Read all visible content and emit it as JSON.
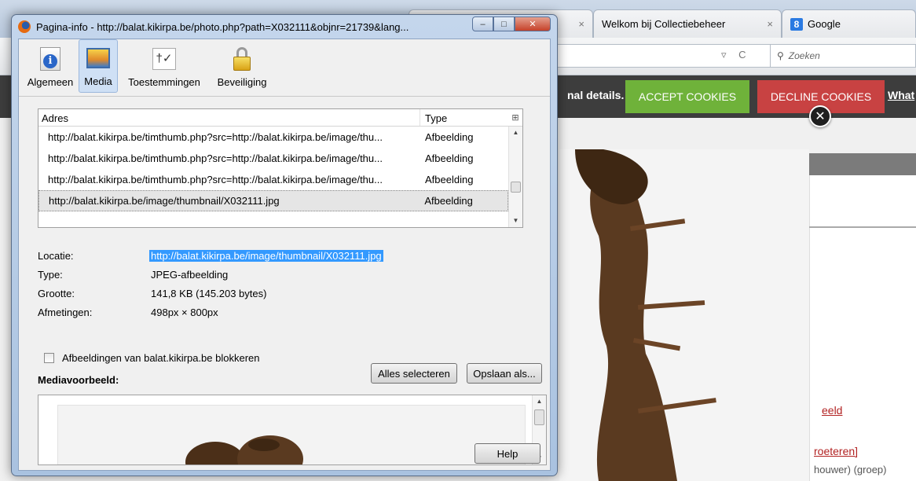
{
  "browser": {
    "tabs": [
      {
        "label": "",
        "close": "×"
      },
      {
        "label": "Welkom bij Collectiebeheer",
        "close": "×"
      },
      {
        "label": "Google",
        "icon": "google-icon"
      }
    ],
    "search_placeholder": "Zoeken",
    "url_icons": "▿ C"
  },
  "cookie_bar": {
    "text": "nal details.",
    "accept_label": "ACCEPT COOKIES",
    "decline_label": "DECLINE COOKIES",
    "what_label": "What",
    "close_glyph": "✕",
    "colors": {
      "accept": "#6fb23a",
      "decline": "#c84242",
      "bar": "#3d3d3d"
    }
  },
  "page_right": {
    "link1": "eeld",
    "link2": "roeteren]",
    "text3": "houwer) (groep)"
  },
  "dialog": {
    "title": "Pagina-info - http://balat.kikirpa.be/photo.php?path=X032111&objnr=21739&lang...",
    "window_buttons": {
      "minimize": "–",
      "maximize": "□",
      "close": "✕"
    },
    "tabs": [
      {
        "label": "Algemeen",
        "icon": "info-icon"
      },
      {
        "label": "Media",
        "icon": "media-icon",
        "active": true
      },
      {
        "label": "Toestemmingen",
        "icon": "permissions-icon"
      },
      {
        "label": "Beveiliging",
        "icon": "lock-icon"
      }
    ],
    "table": {
      "headers": {
        "address": "Adres",
        "type": "Type",
        "picker": "⊞"
      },
      "rows": [
        {
          "address": "http://balat.kikirpa.be/timthumb.php?src=http://balat.kikirpa.be/image/thu...",
          "type": "Afbeelding"
        },
        {
          "address": "http://balat.kikirpa.be/timthumb.php?src=http://balat.kikirpa.be/image/thu...",
          "type": "Afbeelding"
        },
        {
          "address": "http://balat.kikirpa.be/timthumb.php?src=http://balat.kikirpa.be/image/thu...",
          "type": "Afbeelding"
        },
        {
          "address": "http://balat.kikirpa.be/image/thumbnail/X032111.jpg",
          "type": "Afbeelding",
          "selected": true
        }
      ]
    },
    "details": {
      "location_label": "Locatie:",
      "location_value": "http://balat.kikirpa.be/image/thumbnail/X032111.jpg",
      "type_label": "Type:",
      "type_value": "JPEG-afbeelding",
      "size_label": "Grootte:",
      "size_value": "141,8 KB (145.203 bytes)",
      "dims_label": "Afmetingen:",
      "dims_value": "498px × 800px"
    },
    "block_checkbox_label": "Afbeeldingen van balat.kikirpa.be blokkeren",
    "media_preview_label": "Mediavoorbeeld:",
    "buttons": {
      "select_all": "Alles selecteren",
      "save_as": "Opslaan als...",
      "help": "Help"
    }
  }
}
